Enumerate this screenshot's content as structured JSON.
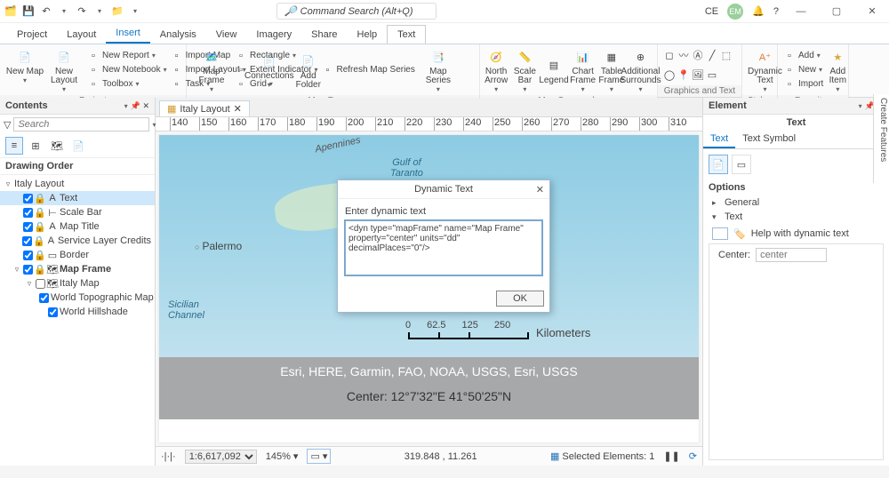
{
  "titlebar": {
    "search_placeholder": "Command Search (Alt+Q)",
    "user": "EM",
    "ce": "CE"
  },
  "menubar": [
    "Project",
    "Layout",
    "Insert",
    "Analysis",
    "View",
    "Imagery",
    "Share",
    "Help",
    "Text"
  ],
  "menubar_active": 2,
  "menubar_box": 8,
  "ribbon": {
    "project": {
      "label": "Project",
      "big": [
        {
          "label": "New Map",
          "sub": "▾"
        },
        {
          "label": "New Layout",
          "sub": "▾"
        }
      ],
      "col1": [
        {
          "label": "New Report",
          "dd": true
        },
        {
          "label": "New Notebook",
          "dd": true
        },
        {
          "label": "Toolbox",
          "dd": true
        }
      ],
      "col2": [
        {
          "label": "Import Map"
        },
        {
          "label": "Import Layout",
          "dd": true
        },
        {
          "label": "Task",
          "dd": true
        }
      ],
      "col3big": [
        {
          "label": "Connections",
          "sub": "▾"
        },
        {
          "label": "Add Folder"
        }
      ]
    },
    "mapframes": {
      "label": "Map Frames",
      "big1": {
        "label": "Map Frame",
        "sub": "▾"
      },
      "col1": [
        {
          "label": "Rectangle",
          "dd": true
        },
        {
          "label": "Extent Indicator",
          "dd": true
        },
        {
          "label": "Grid",
          "dd": true
        }
      ],
      "col2": [
        {
          "label": "Refresh Map Series"
        }
      ],
      "big2": {
        "label": "Map Series",
        "sub": "▾"
      }
    },
    "mapsurrounds": {
      "label": "Map Surrounds",
      "big": [
        {
          "label": "North Arrow",
          "sub": "▾"
        },
        {
          "label": "Scale Bar",
          "sub": "▾"
        },
        {
          "label": "Legend"
        },
        {
          "label": "Chart Frame",
          "sub": "▾"
        },
        {
          "label": "Table Frame",
          "sub": "▾"
        },
        {
          "label": "Additional Surrounds",
          "sub": "▾"
        }
      ]
    },
    "graphics": {
      "label": "Graphics and Text"
    },
    "styles": {
      "label": "Styles",
      "big": {
        "label": "Dynamic Text",
        "sub": "▾"
      }
    },
    "favorites": {
      "label": "Favorites",
      "col": [
        {
          "label": "Add",
          "dd": true
        },
        {
          "label": "New",
          "dd": true
        },
        {
          "label": "Import"
        }
      ],
      "big": {
        "label": "Add Item",
        "sub": "▾"
      }
    }
  },
  "contents": {
    "title": "Contents",
    "search_placeholder": "Search",
    "drawing_order": "Drawing Order",
    "tree": [
      {
        "lvl": 0,
        "exp": "▿",
        "chk": false,
        "label": "Italy Layout"
      },
      {
        "lvl": 1,
        "exp": "",
        "chk": true,
        "sel": true,
        "icons": [
          "lock",
          "A"
        ],
        "label": "Text"
      },
      {
        "lvl": 1,
        "exp": "",
        "chk": true,
        "icons": [
          "lock",
          "bar"
        ],
        "label": "Scale Bar"
      },
      {
        "lvl": 1,
        "exp": "",
        "chk": true,
        "icons": [
          "lock",
          "A"
        ],
        "label": "Map Title"
      },
      {
        "lvl": 1,
        "exp": "",
        "chk": true,
        "icons": [
          "lock",
          "A"
        ],
        "label": "Service Layer Credits"
      },
      {
        "lvl": 1,
        "exp": "",
        "chk": true,
        "icons": [
          "lock",
          "rect"
        ],
        "label": "Border"
      },
      {
        "lvl": 1,
        "exp": "▿",
        "chk": true,
        "bold": true,
        "icons": [
          "lock",
          "frame"
        ],
        "label": "Map Frame"
      },
      {
        "lvl": 2,
        "exp": "▿",
        "chk": false,
        "icons": [
          "map"
        ],
        "label": "Italy Map"
      },
      {
        "lvl": 3,
        "exp": "",
        "chk": true,
        "label": "World Topographic Map"
      },
      {
        "lvl": 3,
        "exp": "",
        "chk": true,
        "label": "World Hillshade"
      }
    ]
  },
  "layout": {
    "tab": "Italy Layout",
    "ruler": [
      "140",
      "150",
      "160",
      "170",
      "180",
      "190",
      "200",
      "210",
      "220",
      "230",
      "240",
      "250",
      "260",
      "270",
      "280",
      "290",
      "300",
      "310"
    ],
    "map": {
      "city": "Palermo",
      "gulf": "Gulf of\nTaranto",
      "channel": "Sicilian\nChannel",
      "apennines": "Apennines"
    },
    "scalebar": {
      "labels": [
        "0",
        "62.5",
        "125",
        "250"
      ],
      "unit": "Kilometers"
    },
    "credits": "Esri, HERE, Garmin, FAO, NOAA, USGS, Esri, USGS",
    "center": "Center: 12°7'32\"E 41°50'25\"N",
    "dialog": {
      "title": "Dynamic Text",
      "label": "Enter dynamic text",
      "value": "<dyn type=\"mapFrame\" name=\"Map Frame\" property=\"center\" units=\"dd\" decimalPlaces=\"0\"/>",
      "ok": "OK"
    },
    "status": {
      "scale": "1:6,617,092",
      "zoom": "145%",
      "coords": "319.848 , 11.261",
      "selected": "Selected Elements: 1"
    }
  },
  "element": {
    "title": "Element",
    "subtitle": "Text",
    "tabs": [
      "Text",
      "Text Symbol"
    ],
    "options": "Options",
    "group1": "General",
    "group2": "Text",
    "help": "Help with dynamic text",
    "center_label": "Center:",
    "center_placeholder": "center"
  },
  "vsidebar": "Create Features"
}
